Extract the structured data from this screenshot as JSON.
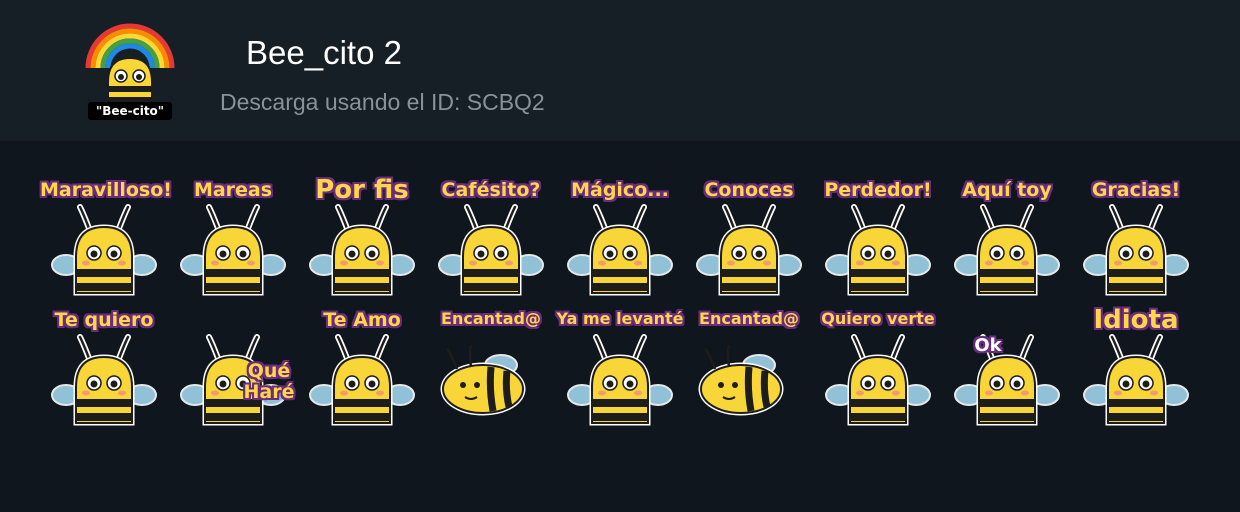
{
  "header": {
    "icon_caption": "\"Bee-cito\"",
    "title": "Bee_cito 2",
    "subtitle": "Descarga usando el ID: SCBQ2"
  },
  "stickers": [
    {
      "caption": "Maravilloso!"
    },
    {
      "caption": "Mareas"
    },
    {
      "caption": "Por fis"
    },
    {
      "caption": "Cafésito?"
    },
    {
      "caption": "Mágico..."
    },
    {
      "caption": "Conoces"
    },
    {
      "caption": "Perdedor!"
    },
    {
      "caption": "Aquí toy"
    },
    {
      "caption": "Gracias!"
    },
    {
      "caption": "Te quiero"
    },
    {
      "caption": "Qué Haré"
    },
    {
      "caption": "Te Amo"
    },
    {
      "caption": "Encantad@"
    },
    {
      "caption": "Ya me levanté"
    },
    {
      "caption": "Encantad@"
    },
    {
      "caption": "Quiero verte"
    },
    {
      "caption": "Ok"
    },
    {
      "caption": "Idiota"
    }
  ],
  "colors": {
    "background": "#0f161d",
    "header": "#161e26",
    "caption_fill": "#ffd54a",
    "caption_outline": "#6a2c7c",
    "bee_yellow": "#f9d637",
    "bee_stripe": "#1d1d1b",
    "wing": "#9fd4ec"
  }
}
